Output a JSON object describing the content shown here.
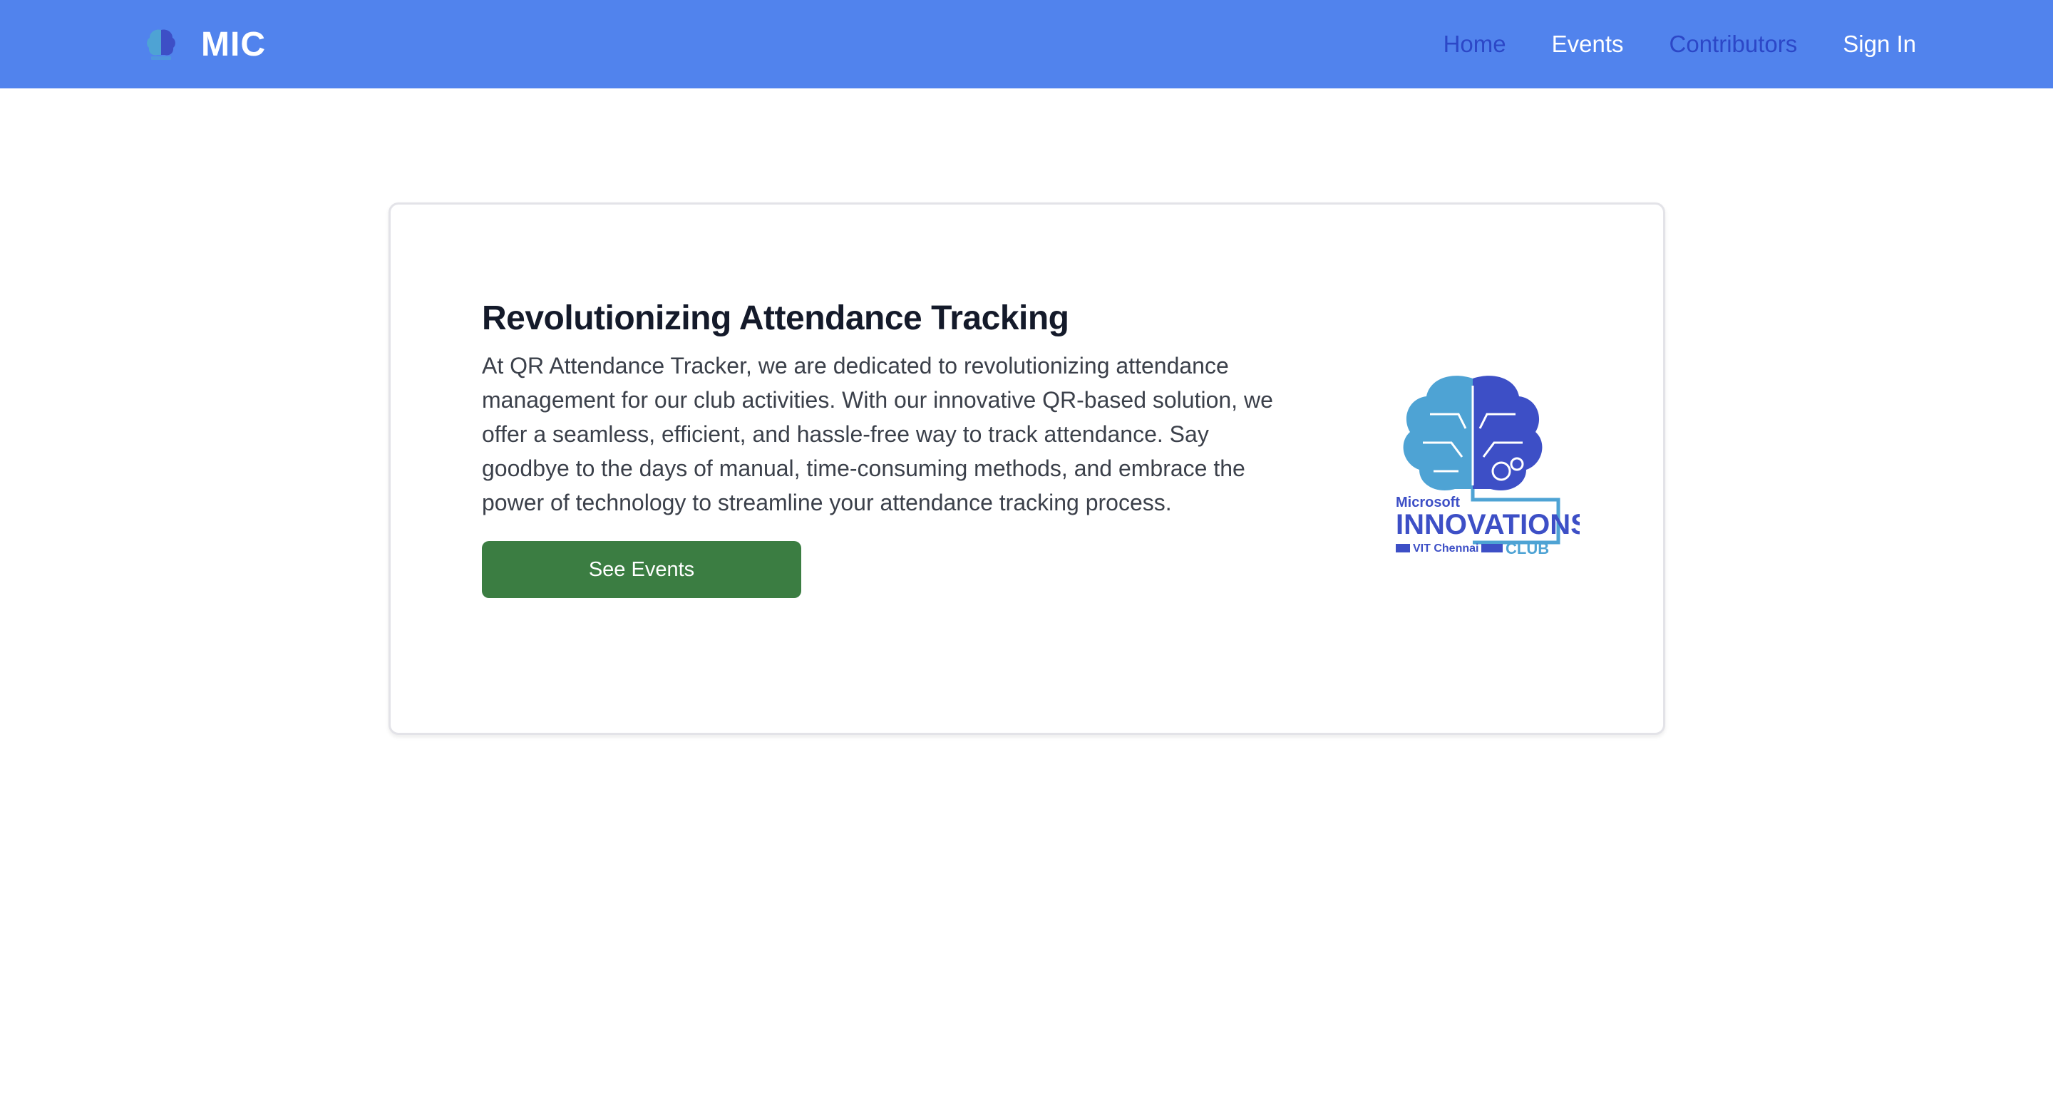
{
  "nav": {
    "brand": "MIC",
    "logo_icon": "brain-logo-icon",
    "links": [
      {
        "label": "Home",
        "active": true
      },
      {
        "label": "Events",
        "active": false
      },
      {
        "label": "Contributors",
        "active": true
      },
      {
        "label": "Sign In",
        "active": false
      }
    ]
  },
  "hero": {
    "title": "Revolutionizing Attendance Tracking",
    "body": "At QR Attendance Tracker, we are dedicated to revolutionizing attendance management for our club activities. With our innovative QR-based solution, we offer a seamless, efficient, and hassle-free way to track attendance. Say goodbye to the days of manual, time-consuming methods, and embrace the power of technology to streamline your attendance tracking process.",
    "button_label": "See Events",
    "logo": {
      "line1": "Microsoft",
      "line2": "INNOVATIONS",
      "line3": "VIT Chennai",
      "line4": "CLUB"
    }
  },
  "colors": {
    "navbar": "#5183ed",
    "nav_active": "#2c47c7",
    "button": "#3b7d42",
    "brain_left": "#4ea3d4",
    "brain_right": "#3d4fc6"
  }
}
